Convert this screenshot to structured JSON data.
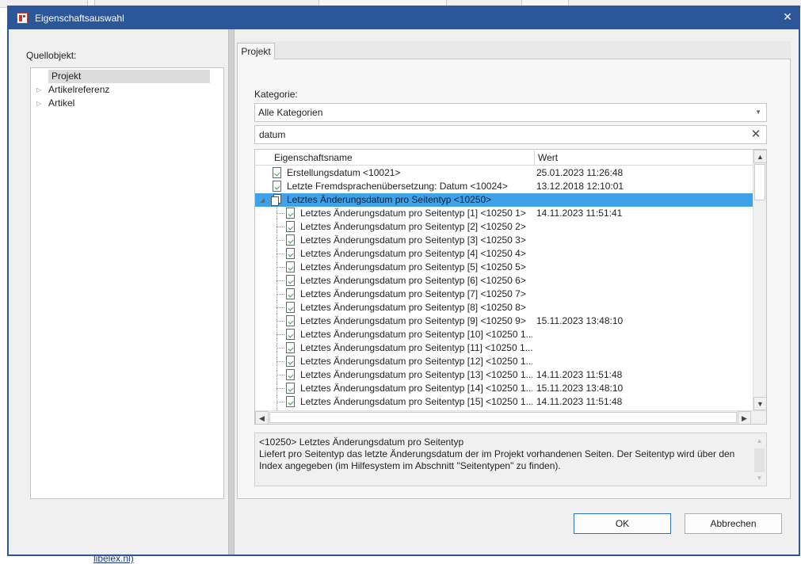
{
  "background": {
    "link_text": "libelex.nl)"
  },
  "dialog": {
    "title": "Eigenschaftsauswahl",
    "close_glyph": "✕",
    "colors": {
      "titlebar": "#2b579a",
      "selection": "#3fa2e8"
    }
  },
  "left": {
    "title": "Quellobjekt:",
    "tree": [
      {
        "label": "Projekt",
        "selected": true,
        "expandable": false
      },
      {
        "label": "Artikelreferenz",
        "selected": false,
        "expandable": true
      },
      {
        "label": "Artikel",
        "selected": false,
        "expandable": true
      }
    ]
  },
  "right": {
    "tab_label": "Projekt",
    "category_label": "Kategorie:",
    "category_value": "Alle Kategorien",
    "search_value": "datum",
    "columns": {
      "name": "Eigenschaftsname",
      "value": "Wert"
    },
    "rows": [
      {
        "name": "Erstellungsdatum <10021>",
        "value": "25.01.2023 11:26:48",
        "level": 0
      },
      {
        "name": "Letzte Fremdsprachenübersetzung: Datum <10024>",
        "value": "13.12.2018 12:10:01",
        "level": 0
      },
      {
        "name": "Letztes Änderungsdatum pro Seitentyp <10250>",
        "value": "",
        "level": 0,
        "group": true,
        "selected": true
      },
      {
        "name": "Letztes Änderungsdatum pro Seitentyp [1] <10250 1>",
        "value": "14.11.2023 11:51:41",
        "level": 1
      },
      {
        "name": "Letztes Änderungsdatum pro Seitentyp [2] <10250 2>",
        "value": "",
        "level": 1
      },
      {
        "name": "Letztes Änderungsdatum pro Seitentyp [3] <10250 3>",
        "value": "",
        "level": 1
      },
      {
        "name": "Letztes Änderungsdatum pro Seitentyp [4] <10250 4>",
        "value": "",
        "level": 1
      },
      {
        "name": "Letztes Änderungsdatum pro Seitentyp [5] <10250 5>",
        "value": "",
        "level": 1
      },
      {
        "name": "Letztes Änderungsdatum pro Seitentyp [6] <10250 6>",
        "value": "",
        "level": 1
      },
      {
        "name": "Letztes Änderungsdatum pro Seitentyp [7] <10250 7>",
        "value": "",
        "level": 1
      },
      {
        "name": "Letztes Änderungsdatum pro Seitentyp [8] <10250 8>",
        "value": "",
        "level": 1
      },
      {
        "name": "Letztes Änderungsdatum pro Seitentyp [9] <10250 9>",
        "value": "15.11.2023 13:48:10",
        "level": 1
      },
      {
        "name": "Letztes Änderungsdatum pro Seitentyp [10] <10250 1...",
        "value": "",
        "level": 1
      },
      {
        "name": "Letztes Änderungsdatum pro Seitentyp [11] <10250 1...",
        "value": "",
        "level": 1
      },
      {
        "name": "Letztes Änderungsdatum pro Seitentyp [12] <10250 1...",
        "value": "",
        "level": 1
      },
      {
        "name": "Letztes Änderungsdatum pro Seitentyp [13] <10250 1...",
        "value": "14.11.2023 11:51:48",
        "level": 1
      },
      {
        "name": "Letztes Änderungsdatum pro Seitentyp [14] <10250 1...",
        "value": "15.11.2023 13:48:10",
        "level": 1
      },
      {
        "name": "Letztes Änderungsdatum pro Seitentyp [15] <10250 1...",
        "value": "14.11.2023 11:51:48",
        "level": 1
      }
    ],
    "description": {
      "title": "<10250> Letztes Änderungsdatum pro Seitentyp",
      "text": "Liefert pro Seitentyp das letzte Änderungsdatum der im Projekt vorhandenen Seiten. Der Seitentyp wird über den Index angegeben (im Hilfesystem im Abschnitt \"Seitentypen\" zu finden)."
    }
  },
  "buttons": {
    "ok": "OK",
    "cancel": "Abbrechen"
  }
}
